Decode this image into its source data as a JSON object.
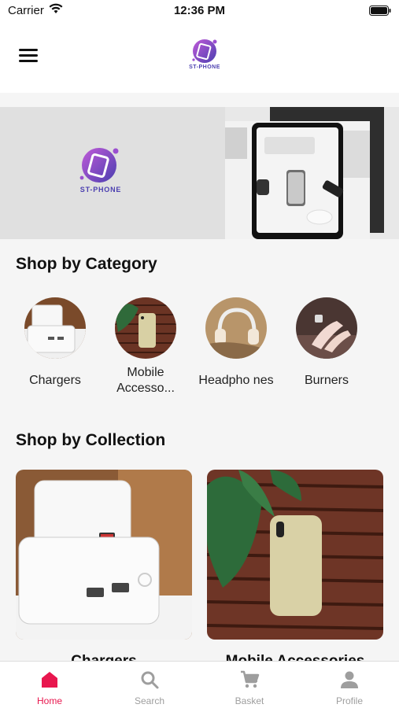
{
  "status": {
    "carrier": "Carrier",
    "time": "12:36 PM"
  },
  "header": {
    "logo_text": "ST-PHONE"
  },
  "banner": {
    "logo_text": "ST-PHONE"
  },
  "categories": {
    "title": "Shop by Category",
    "items": [
      {
        "label": "Chargers"
      },
      {
        "label": "Mobile Accesso..."
      },
      {
        "label": "Headpho nes"
      },
      {
        "label": "Burners"
      }
    ]
  },
  "collections": {
    "title": "Shop by Collection",
    "items": [
      {
        "label": "Chargers"
      },
      {
        "label": "Mobile Accessories"
      }
    ]
  },
  "tabs": [
    {
      "label": "Home",
      "icon": "home-icon",
      "active": true
    },
    {
      "label": "Search",
      "icon": "search-icon",
      "active": false
    },
    {
      "label": "Basket",
      "icon": "cart-icon",
      "active": false
    },
    {
      "label": "Profile",
      "icon": "profile-icon",
      "active": false
    }
  ],
  "colors": {
    "accent": "#e8174e",
    "brand": "#4b3fb0",
    "inactive": "#9e9e9e"
  }
}
